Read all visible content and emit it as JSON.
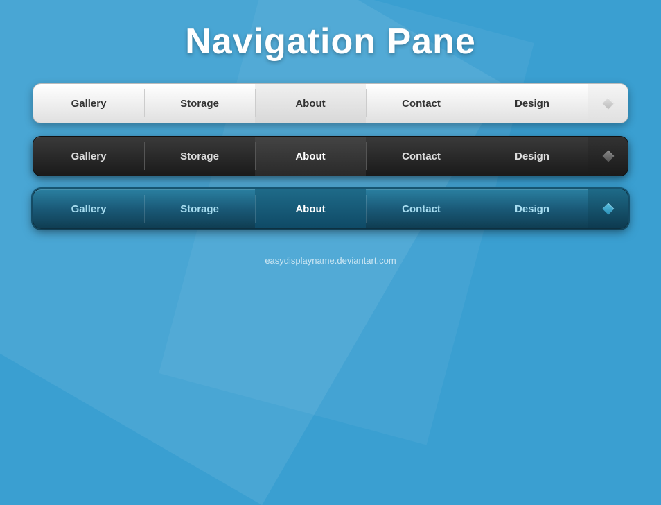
{
  "page": {
    "title": "Navigation Pane",
    "footer": "easydisplayname.deviantart.com"
  },
  "nav_white": {
    "items": [
      {
        "label": "Gallery",
        "active": false
      },
      {
        "label": "Storage",
        "active": false
      },
      {
        "label": "About",
        "active": true
      },
      {
        "label": "Contact",
        "active": false
      },
      {
        "label": "Design",
        "active": false
      }
    ]
  },
  "nav_dark": {
    "items": [
      {
        "label": "Gallery",
        "active": false
      },
      {
        "label": "Storage",
        "active": false
      },
      {
        "label": "About",
        "active": true
      },
      {
        "label": "Contact",
        "active": false
      },
      {
        "label": "Design",
        "active": false
      }
    ]
  },
  "nav_teal": {
    "items": [
      {
        "label": "Gallery",
        "active": false
      },
      {
        "label": "Storage",
        "active": false
      },
      {
        "label": "About",
        "active": true
      },
      {
        "label": "Contact",
        "active": false
      },
      {
        "label": "Design",
        "active": false
      }
    ]
  }
}
